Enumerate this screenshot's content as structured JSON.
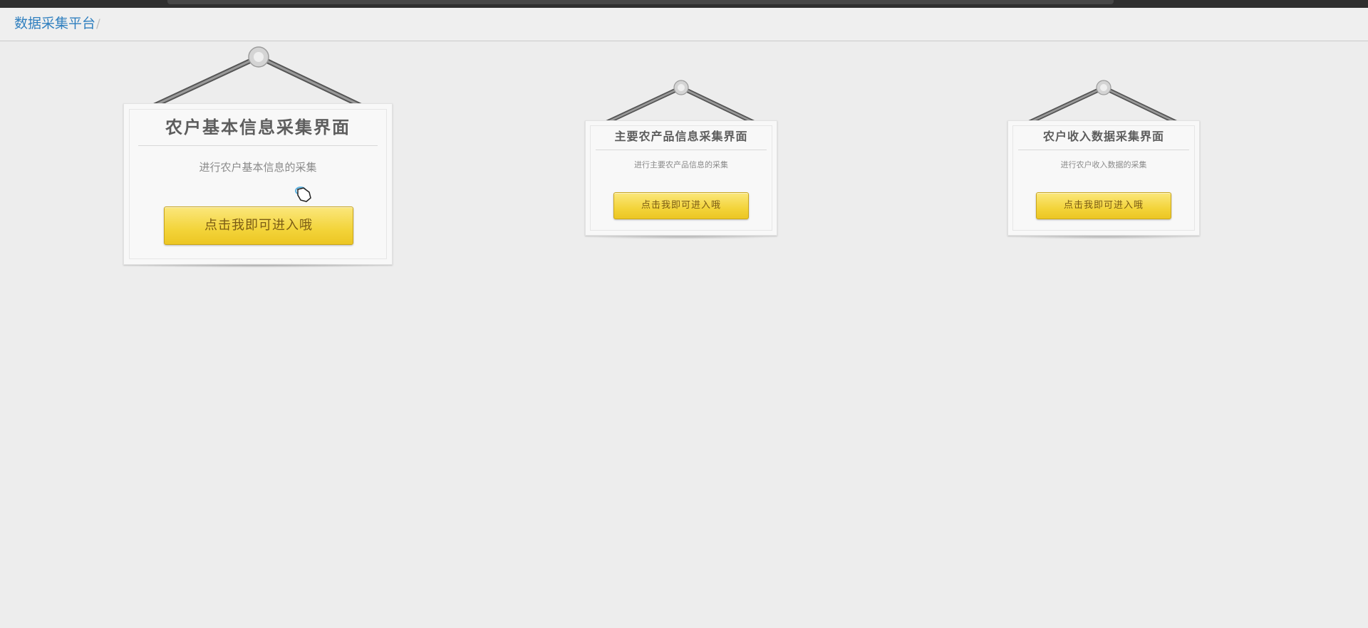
{
  "breadcrumb": {
    "home": "数据采集平台",
    "separator": "/"
  },
  "cards": [
    {
      "title": "农户基本信息采集界面",
      "description": "进行农户基本信息的采集",
      "button": "点击我即可进入哦"
    },
    {
      "title": "主要农产品信息采集界面",
      "description": "进行主要农产品信息的采集",
      "button": "点击我即可进入哦"
    },
    {
      "title": "农户收入数据采集界面",
      "description": "进行农户收入数据的采集",
      "button": "点击我即可进入哦"
    }
  ],
  "colors": {
    "button_yellow": "#f3d43a",
    "link_blue": "#2f7fbf"
  },
  "icons": [
    "hanger-pin-icon",
    "hand-cursor-icon"
  ]
}
